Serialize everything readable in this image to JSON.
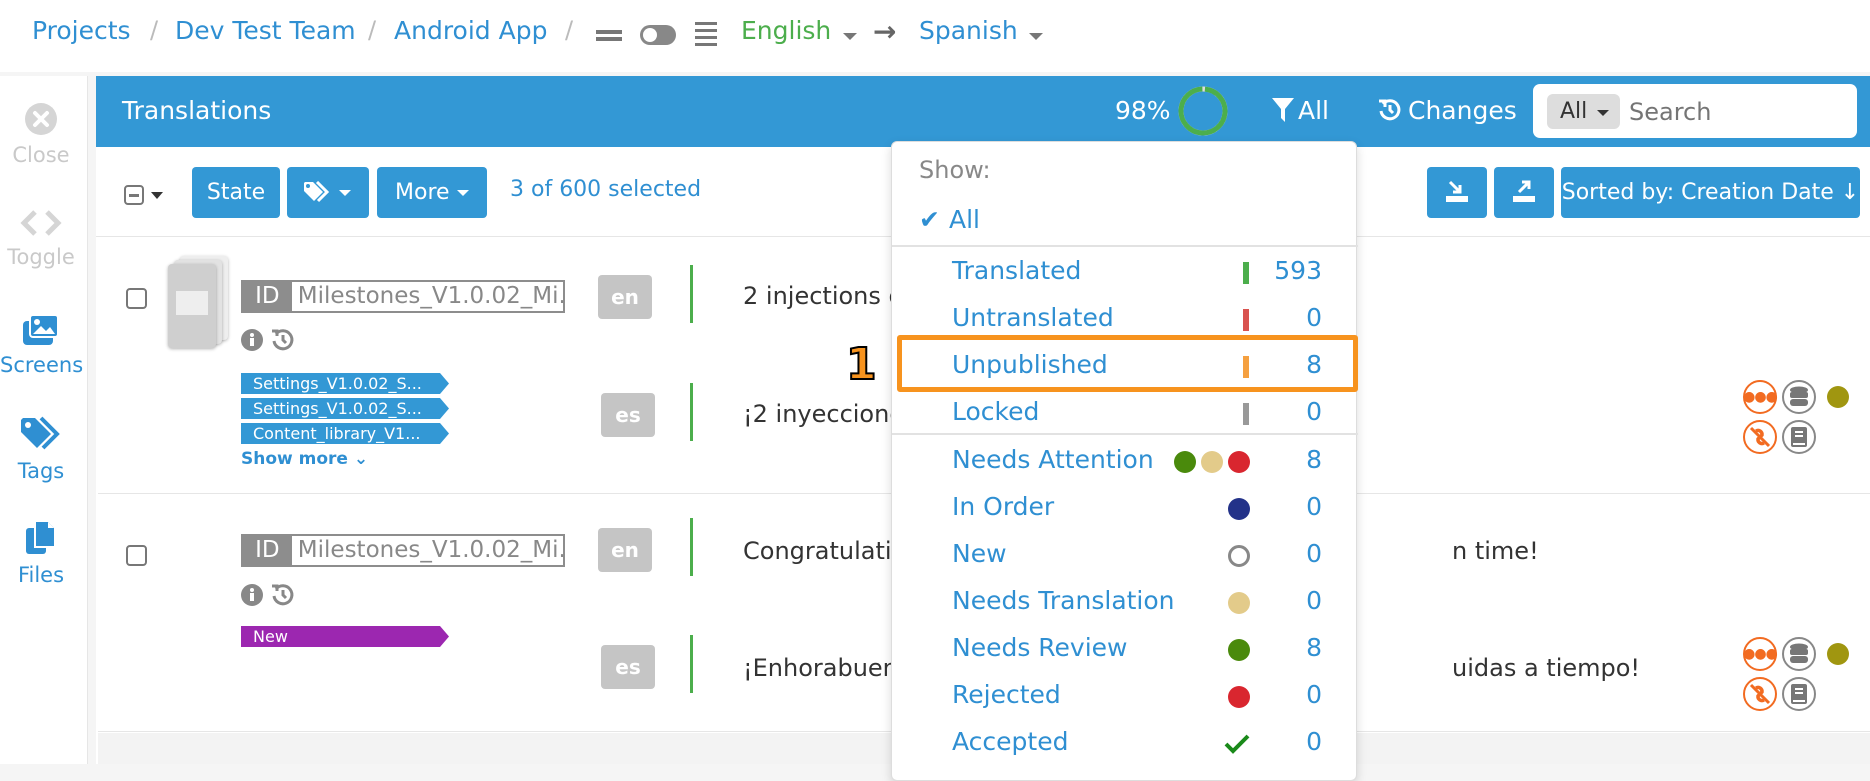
{
  "breadcrumb": {
    "items": [
      "Projects",
      "Dev Test Team",
      "Android App"
    ],
    "separator": "/",
    "source_language": "English",
    "target_language": "Spanish"
  },
  "sidebar": {
    "items": [
      {
        "label": "Close",
        "icon": "close-circle-icon",
        "enabled": false
      },
      {
        "label": "Toggle",
        "icon": "code-brackets-icon",
        "enabled": false
      },
      {
        "label": "Screens",
        "icon": "images-icon",
        "enabled": true
      },
      {
        "label": "Tags",
        "icon": "tags-icon",
        "enabled": true
      },
      {
        "label": "Files",
        "icon": "files-icon",
        "enabled": true
      }
    ]
  },
  "header": {
    "title": "Translations",
    "progress_label": "98%",
    "progress_value": 0.98,
    "filter_label": "All",
    "changes_label": "Changes",
    "search_scope": "All",
    "search_placeholder": "Search"
  },
  "toolbar": {
    "state_label": "State",
    "more_label": "More",
    "selection_text": "3 of 600 selected",
    "sort_label": "Sorted by: Creation Date"
  },
  "rows": [
    {
      "id_label": "ID",
      "key": "Milestones_V1.0.02_Mi...",
      "tags": [
        {
          "label": "Settings_V1.0.02_S...",
          "color": "#3398d5"
        },
        {
          "label": "Settings_V1.0.02_S...",
          "color": "#3398d5"
        },
        {
          "label": "Content_library_V1...",
          "color": "#3398d5"
        }
      ],
      "show_more": "Show more",
      "source_lang": "en",
      "source_text": "2 injections c",
      "target_lang": "es",
      "target_text": "¡2 inyeccione",
      "has_screenshot": true
    },
    {
      "id_label": "ID",
      "key": "Milestones_V1.0.02_Mi...",
      "tags": [
        {
          "label": "New",
          "color": "#9c27b0"
        }
      ],
      "source_lang": "en",
      "source_text": "Congratulatio",
      "source_text_tail": "n time!",
      "target_lang": "es",
      "target_text": "¡Enhorabuen",
      "target_text_tail": "uidas a tiempo!",
      "has_screenshot": false
    }
  ],
  "dropdown": {
    "heading": "Show:",
    "selected": "All",
    "groups": [
      [
        {
          "label": "Translated",
          "count": "593",
          "marker": "bar",
          "color": "#4cae4c"
        },
        {
          "label": "Untranslated",
          "count": "0",
          "marker": "bar",
          "color": "#d9534f"
        },
        {
          "label": "Unpublished",
          "count": "8",
          "marker": "bar",
          "color": "#f5a040",
          "highlighted": true
        },
        {
          "label": "Locked",
          "count": "0",
          "marker": "bar",
          "color": "#999999"
        }
      ],
      [
        {
          "label": "Needs Attention",
          "count": "8",
          "marker": "dots",
          "colors": [
            "#4a8a0c",
            "#e3cb8a",
            "#d9262f"
          ]
        },
        {
          "label": "In Order",
          "count": "0",
          "marker": "dot",
          "color": "#233289"
        },
        {
          "label": "New",
          "count": "0",
          "marker": "ring",
          "color": "#888888"
        },
        {
          "label": "Needs Translation",
          "count": "0",
          "marker": "dot",
          "color": "#e3cb8a"
        },
        {
          "label": "Needs Review",
          "count": "8",
          "marker": "dot",
          "color": "#4a8a0c"
        },
        {
          "label": "Rejected",
          "count": "0",
          "marker": "dot",
          "color": "#d9262f"
        },
        {
          "label": "Accepted",
          "count": "0",
          "marker": "check",
          "color": "#1a8a1a"
        }
      ]
    ]
  },
  "annotation": {
    "label": "1",
    "color": "#f7931e"
  },
  "colors": {
    "accent": "#3398d5",
    "link": "#2f8fd2",
    "source_lang": "#4cae4c",
    "status_olive": "#a09610",
    "orange": "#f26b21"
  }
}
